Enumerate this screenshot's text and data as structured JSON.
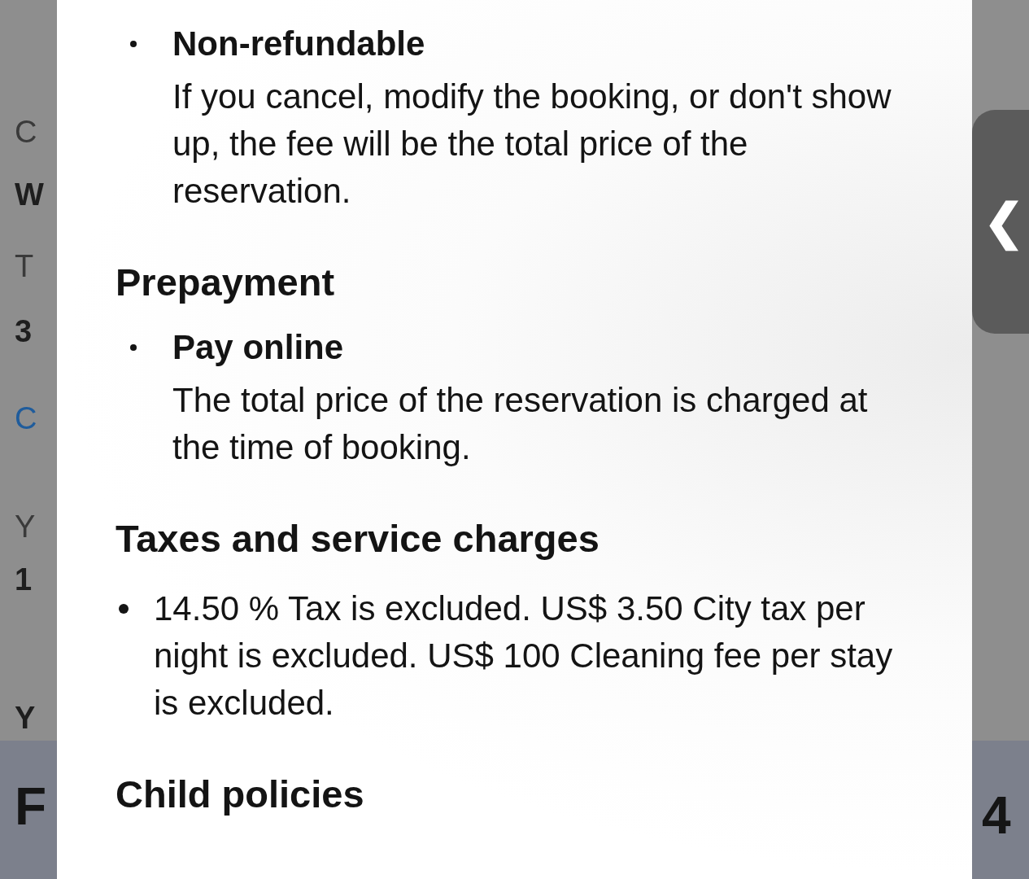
{
  "background_page": {
    "left_edge": [
      {
        "text": "C",
        "kind": "muted"
      },
      {
        "text": "W",
        "kind": "bold"
      },
      {
        "text": "T",
        "kind": "muted"
      },
      {
        "text": "3",
        "kind": "bold"
      },
      {
        "text": "C",
        "kind": "link"
      },
      {
        "text": "Y",
        "kind": "muted"
      },
      {
        "text": "1",
        "kind": "bold"
      },
      {
        "text": "Y",
        "kind": "bold"
      },
      {
        "text": "F",
        "kind": "price"
      }
    ],
    "right_edge": [
      {
        "text": "4",
        "kind": "price"
      }
    ],
    "side_tab": {
      "glyph": "❮"
    }
  },
  "modal": {
    "sections": [
      {
        "items": [
          {
            "kind": "titled",
            "title": "Non-refundable",
            "text": "If you cancel, modify the booking, or don't show up, the fee will be the total price of the reservation."
          }
        ]
      },
      {
        "heading": "Prepayment",
        "items": [
          {
            "kind": "titled",
            "title": "Pay online",
            "text": "The total price of the reservation is charged at the time of booking."
          }
        ]
      },
      {
        "heading": "Taxes and service charges",
        "items": [
          {
            "kind": "plain",
            "text": "14.50 % Tax is excluded. US$ 3.50 City tax per night is excluded. US$ 100 Cleaning fee per stay is excluded."
          }
        ]
      },
      {
        "heading": "Child policies"
      }
    ]
  }
}
